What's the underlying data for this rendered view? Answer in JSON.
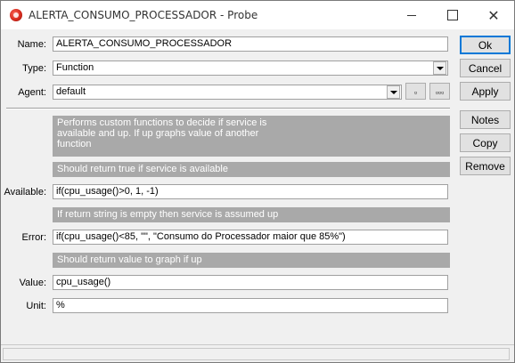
{
  "window": {
    "title": "ALERTA_CONSUMO_PROCESSADOR - Probe"
  },
  "form": {
    "name_label": "Name:",
    "name_value": "ALERTA_CONSUMO_PROCESSADOR",
    "type_label": "Type:",
    "type_value": "Function",
    "agent_label": "Agent:",
    "agent_value": "default",
    "agent_btn1": "▫",
    "agent_btn2": "▫▫▫",
    "info1": "Performs custom functions to decide if service is available and up. If up graphs value of another function",
    "info2": "Should return true if service is available",
    "available_label": "Available:",
    "available_value": "if(cpu_usage()>0, 1, -1)",
    "info3": "If return string is empty then service is assumed up",
    "error_label": "Error:",
    "error_value": "if(cpu_usage()<85, \"\", \"Consumo do Processador maior que 85%\")",
    "info4": "Should return value to graph if up",
    "value_label": "Value:",
    "value_value": "cpu_usage()",
    "unit_label": "Unit:",
    "unit_value": "%"
  },
  "buttons": {
    "ok": "Ok",
    "cancel": "Cancel",
    "apply": "Apply",
    "notes": "Notes",
    "copy": "Copy",
    "remove": "Remove"
  },
  "icons": {
    "app": "probe-app-icon",
    "minimize": "minimize-icon",
    "maximize": "maximize-icon",
    "close": "close-icon",
    "dropdown": "chevron-down-icon"
  },
  "colors": {
    "info_band": "#a9a9a9",
    "default_button_border": "#0078d7"
  }
}
